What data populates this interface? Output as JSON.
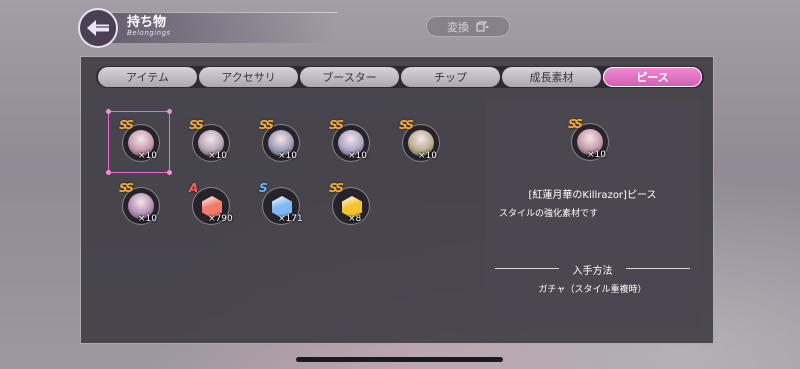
{
  "header": {
    "title": "持ち物",
    "subtitle": "Belongings",
    "convert_label": "変換",
    "back_icon": "back-arrow-icon",
    "convert_icon": "cube-convert-icon"
  },
  "tabs": [
    {
      "label": "アイテム",
      "active": false
    },
    {
      "label": "アクセサリ",
      "active": false
    },
    {
      "label": "ブースター",
      "active": false
    },
    {
      "label": "チップ",
      "active": false
    },
    {
      "label": "成長素材",
      "active": false
    },
    {
      "label": "ピース",
      "active": true
    }
  ],
  "items": [
    {
      "rank": "SS",
      "count": "×10",
      "kind": "portrait",
      "color": "#c89aa8"
    },
    {
      "rank": "SS",
      "count": "×10",
      "kind": "portrait",
      "color": "#b7a4b7"
    },
    {
      "rank": "SS",
      "count": "×10",
      "kind": "portrait",
      "color": "#9d9bb8"
    },
    {
      "rank": "SS",
      "count": "×10",
      "kind": "portrait",
      "color": "#a8a6c4"
    },
    {
      "rank": "SS",
      "count": "×10",
      "kind": "portrait",
      "color": "#b9ad8c"
    },
    {
      "rank": "SS",
      "count": "×10",
      "kind": "portrait",
      "color": "#b48fb6"
    },
    {
      "rank": "A",
      "count": "×790",
      "kind": "gem",
      "color": "#f47a6c"
    },
    {
      "rank": "S",
      "count": "×171",
      "kind": "gem",
      "color": "#7fb8f2"
    },
    {
      "rank": "SS",
      "count": "×8",
      "kind": "gem",
      "color": "#f5c230"
    }
  ],
  "detail": {
    "rank": "SS",
    "count": "×10",
    "color": "#c89aa8",
    "name": "[紅蓮月華のKillrazor]ピース",
    "description": "スタイルの強化素材です",
    "acquire_heading": "入手方法",
    "acquire_source": "ガチャ（スタイル重複時）"
  },
  "colors": {
    "accent": "#e56dc7",
    "panel": "#3c3a42"
  }
}
